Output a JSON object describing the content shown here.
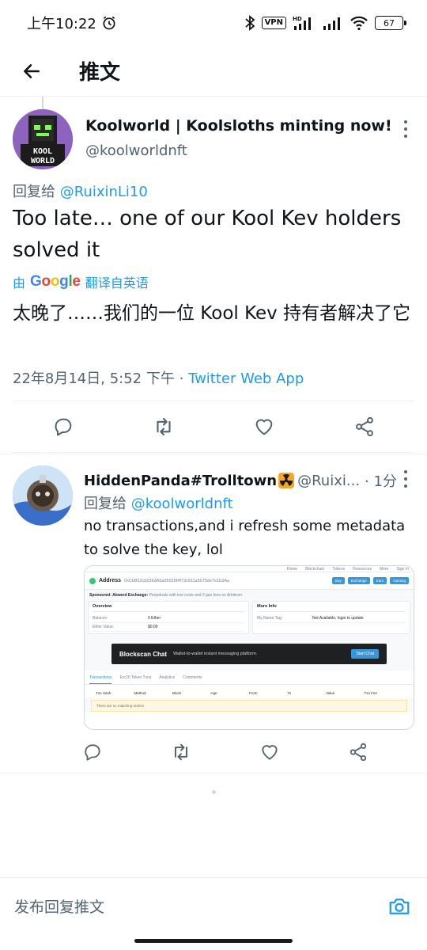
{
  "status_bar": {
    "time": "上午10:22",
    "vpn": "VPN",
    "network": "HD",
    "battery": "67"
  },
  "header": {
    "title": "推文"
  },
  "main_tweet": {
    "author_name": "Koolworld | Koolsloths minting now!",
    "author_handle": "@koolworldnft",
    "reply_prefix": "回复给",
    "reply_to": "@RuixinLi10",
    "text": "Too late… one of our Kool Kev holders solved it",
    "translate_by": "由",
    "translate_brand": "Google",
    "translate_label": "翻译自英语",
    "translated_text": "太晚了……我们的一位 Kool Kev 持有者解决了它",
    "timestamp": "22年8月14日, 5:52 下午",
    "separator": "·",
    "app": "Twitter Web App"
  },
  "reply_tweet": {
    "author_name": "HiddenPanda#Trolltown",
    "author_handle": "@Ruixi...",
    "time": "· 1分",
    "reply_prefix": "回复给",
    "reply_to": "@koolworldnft",
    "text": "no transactions,and i refresh some metadata to solve the key, lol",
    "media": {
      "top_nav": [
        "Home",
        "Blockchain",
        "Tokens",
        "Resources",
        "More",
        "Sign In"
      ],
      "address_label": "Address",
      "address_value": "0xCbB52cb036dA5a95928f4f73c811a5075de7e1b3Aa",
      "buttons": [
        "Buy",
        "Exchange",
        "Earn",
        "Gaming"
      ],
      "sponsored": "Sponsored:",
      "sponsored_brand": "Abwerd Exchange:",
      "sponsored_text": "Perpetuals with low costs and 0 gas fees on Arbitrum.",
      "overview_title": "Overview",
      "balance_label": "Balance:",
      "balance_value": "0 Ether",
      "ether_value_label": "Ether Value:",
      "ether_value_value": "$0.00",
      "more_info_title": "More Info",
      "name_tag_label": "My Name Tag:",
      "name_tag_value": "Not Available, login to update",
      "banner_logo": "Blockscan Chat",
      "banner_text": "Wallet-to-wallet instant messaging platform.",
      "banner_button": "Start Chat",
      "tabs": [
        "Transactions",
        "Erc20 Token Txns",
        "Analytics",
        "Comments"
      ],
      "table_headers": [
        "Txn Hash",
        "Method",
        "Block",
        "Age",
        "From",
        "To",
        "Value",
        "Txn Fee"
      ],
      "empty_message": "There are no matching entries"
    }
  },
  "compose": {
    "placeholder": "发布回复推文"
  },
  "colors": {
    "accent": "#1d9bf0",
    "text": "#0f1419",
    "secondary": "#536471",
    "border": "#eff3f4"
  }
}
